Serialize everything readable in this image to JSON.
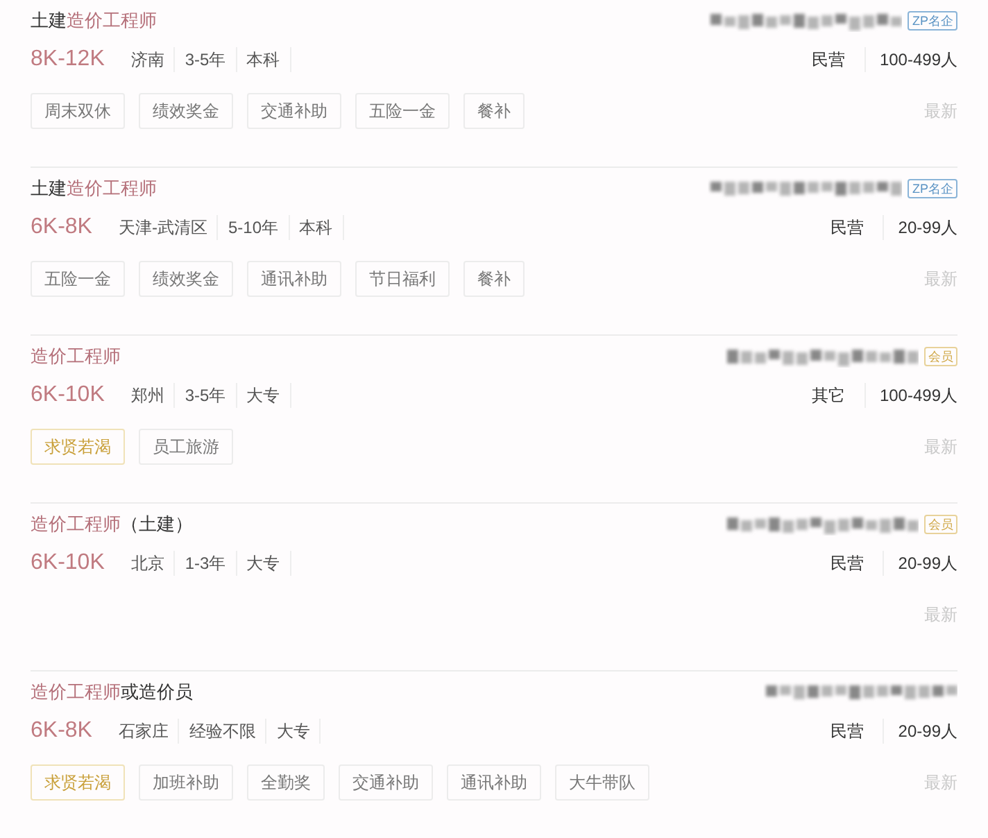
{
  "jobs": [
    {
      "title": [
        {
          "text": "土建",
          "highlight": false
        },
        {
          "text": "造价工程师",
          "highlight": true
        }
      ],
      "badge": {
        "text": "ZP名企",
        "kind": "brand"
      },
      "salary": "8K-12K",
      "details": [
        "济南",
        "3-5年",
        "本科"
      ],
      "company_type": "民营",
      "company_size": "100-499人",
      "tags": [
        {
          "text": "周末双休",
          "featured": false
        },
        {
          "text": "绩效奖金",
          "featured": false
        },
        {
          "text": "交通补助",
          "featured": false
        },
        {
          "text": "五险一金",
          "featured": false
        },
        {
          "text": "餐补",
          "featured": false
        }
      ],
      "posted": "最新"
    },
    {
      "title": [
        {
          "text": "土建",
          "highlight": false
        },
        {
          "text": "造价工程师",
          "highlight": true
        }
      ],
      "badge": {
        "text": "ZP名企",
        "kind": "brand"
      },
      "salary": "6K-8K",
      "details": [
        "天津-武清区",
        "5-10年",
        "本科"
      ],
      "company_type": "民营",
      "company_size": "20-99人",
      "tags": [
        {
          "text": "五险一金",
          "featured": false
        },
        {
          "text": "绩效奖金",
          "featured": false
        },
        {
          "text": "通讯补助",
          "featured": false
        },
        {
          "text": "节日福利",
          "featured": false
        },
        {
          "text": "餐补",
          "featured": false
        }
      ],
      "posted": "最新"
    },
    {
      "title": [
        {
          "text": "造价工程师",
          "highlight": true
        }
      ],
      "badge": {
        "text": "会员",
        "kind": "member"
      },
      "salary": "6K-10K",
      "details": [
        "郑州",
        "3-5年",
        "大专"
      ],
      "company_type": "其它",
      "company_size": "100-499人",
      "tags": [
        {
          "text": "求贤若渴",
          "featured": true
        },
        {
          "text": "员工旅游",
          "featured": false
        }
      ],
      "posted": "最新"
    },
    {
      "title": [
        {
          "text": "造价工程师",
          "highlight": true
        },
        {
          "text": "（土建）",
          "highlight": false
        }
      ],
      "badge": {
        "text": "会员",
        "kind": "member"
      },
      "salary": "6K-10K",
      "details": [
        "北京",
        "1-3年",
        "大专"
      ],
      "company_type": "民营",
      "company_size": "20-99人",
      "posted": "最新"
    },
    {
      "title": [
        {
          "text": "造价工程师",
          "highlight": true
        },
        {
          "text": "或造价员",
          "highlight": false
        }
      ],
      "salary": "6K-8K",
      "details": [
        "石家庄",
        "经验不限",
        "大专"
      ],
      "company_type": "民营",
      "company_size": "20-99人",
      "tags": [
        {
          "text": "求贤若渴",
          "featured": true
        },
        {
          "text": "加班补助",
          "featured": false
        },
        {
          "text": "全勤奖",
          "featured": false
        },
        {
          "text": "交通补助",
          "featured": false
        },
        {
          "text": "通讯补助",
          "featured": false
        },
        {
          "text": "大牛带队",
          "featured": false
        }
      ],
      "posted": "最新"
    }
  ]
}
